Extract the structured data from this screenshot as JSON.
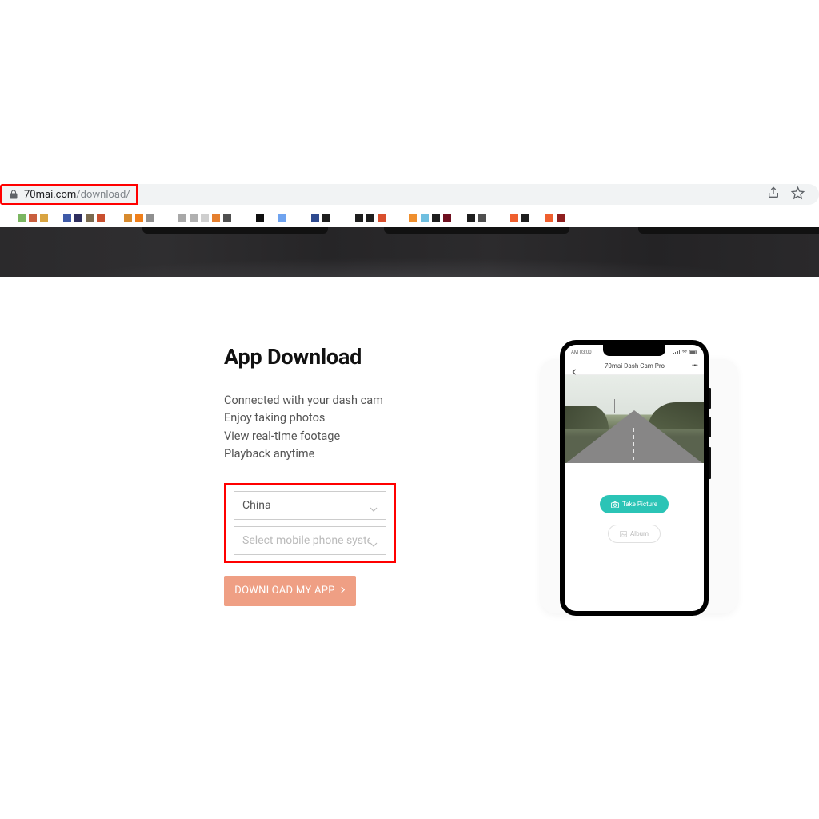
{
  "browser": {
    "url_domain": "70mai.com",
    "url_path": "/download/",
    "bookmarks_colors": [
      "#7bb661",
      "#c95f3e",
      "#d9a441",
      "#3e5aa8",
      "#2e2e5e",
      "#7a6a4f",
      "#c94f2e",
      "#d78a2e",
      "#ef7f1a",
      "#8f8f8f",
      "#a8a8a8",
      "#b0b0b0",
      "#cfcfcf",
      "#e57f2e",
      "#4f4f4f",
      "#0f0f0f",
      "#ffffff",
      "#6fa3ef",
      "#2e4a8f",
      "#1e1e1e",
      "#1e1e1e",
      "#1e1e1e",
      "#d94f2e",
      "#ef8f2e",
      "#6fbfe0",
      "#1e1e1e",
      "#6f0f1f",
      "#1e1e1e",
      "#4f4f4f",
      "#ef5f2e",
      "#1e1e1e",
      "#ef5f2e",
      "#8f1f1f"
    ]
  },
  "page": {
    "title": "App Download",
    "features": [
      "Connected with your dash cam",
      "Enjoy taking photos",
      "View real-time footage",
      "Playback anytime"
    ],
    "select_country": "China",
    "select_system_placeholder": "Select mobile phone system",
    "download_btn": "DOWNLOAD MY APP"
  },
  "phone": {
    "status_time": "AM 03:00",
    "app_title": "70mai Dash Cam Pro",
    "take_picture": "Take Picture",
    "album": "Album"
  }
}
